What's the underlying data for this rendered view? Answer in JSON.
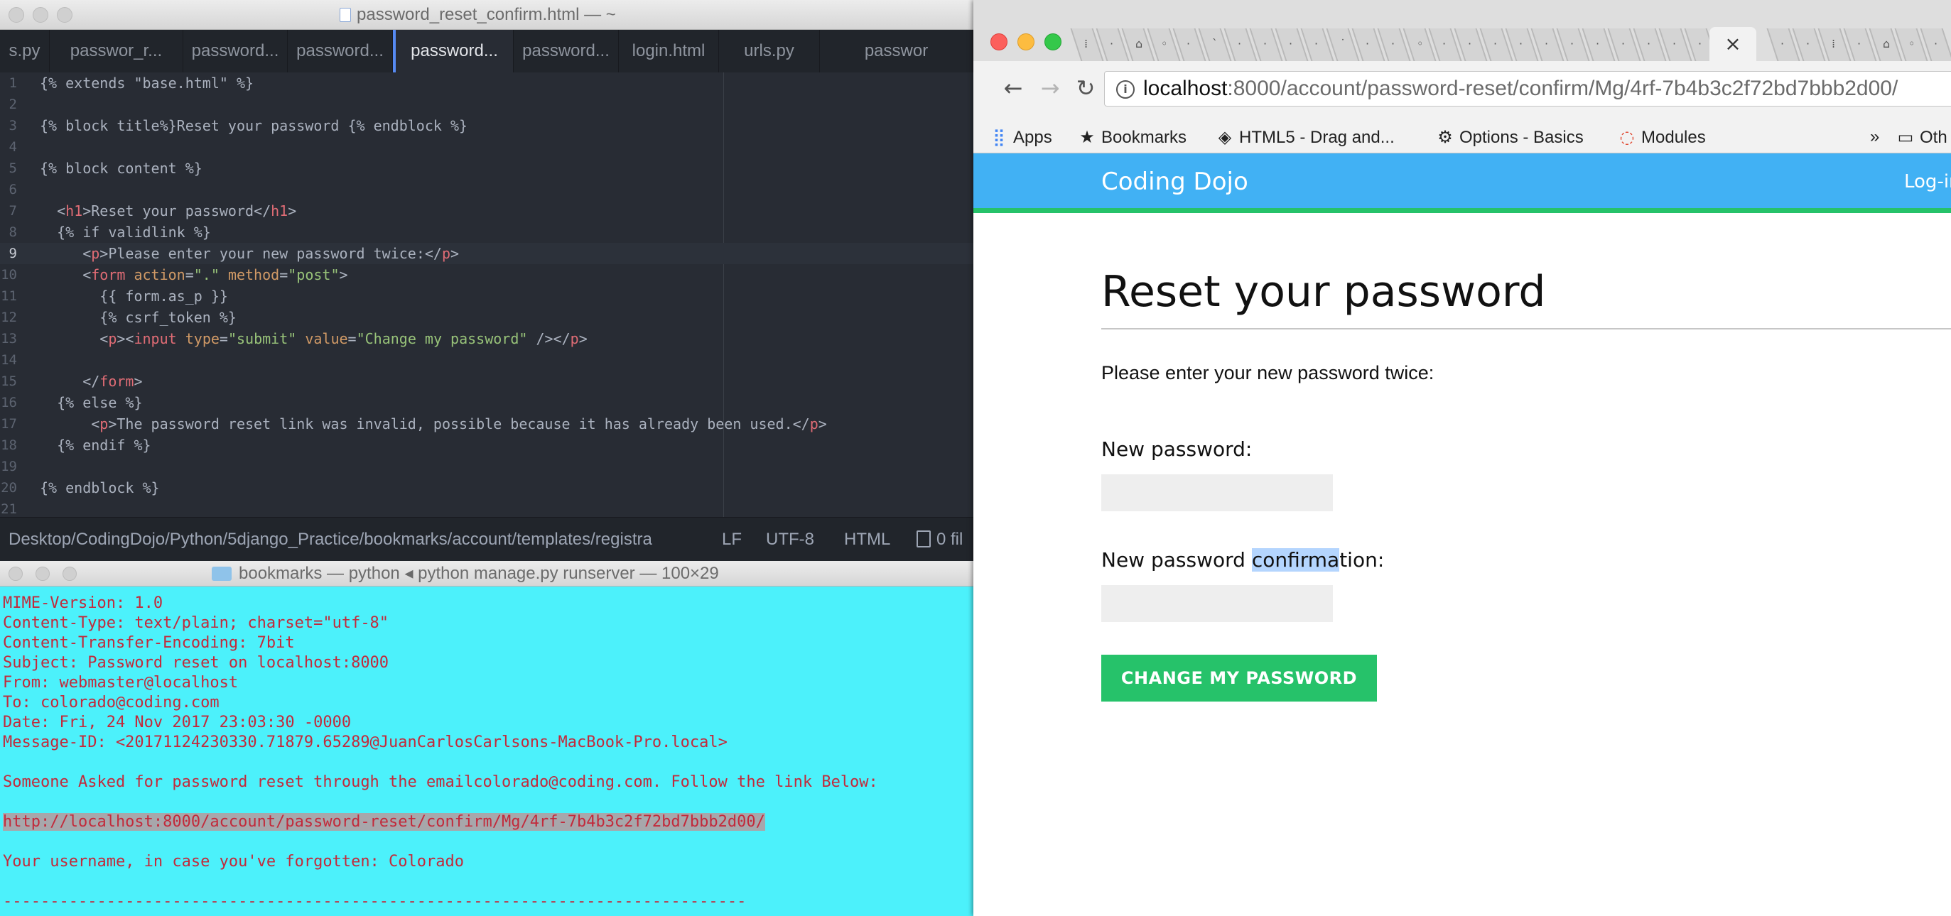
{
  "editor": {
    "window_title": "password_reset_confirm.html — ~",
    "tabs": [
      "s.py",
      "passwor_r...",
      "password...",
      "password...",
      "password...",
      "password...",
      "login.html",
      "urls.py",
      "passwor"
    ],
    "active_tab_index": 4,
    "line_numbers": [
      "1",
      "2",
      "3",
      "4",
      "5",
      "6",
      "7",
      "8",
      "9",
      "10",
      "11",
      "12",
      "13",
      "14",
      "15",
      "16",
      "17",
      "18",
      "19",
      "20",
      "21"
    ],
    "current_line": 9,
    "status": {
      "path": "Desktop/CodingDojo/Python/5django_Practice/bookmarks/account/templates/registra",
      "line_ending": "LF",
      "encoding": "UTF-8",
      "grammar": "HTML",
      "files": "0 fil"
    }
  },
  "terminal": {
    "window_title": "bookmarks — python ◂ python manage.py runserver — 100×29",
    "lines": [
      "MIME-Version: 1.0",
      "Content-Type: text/plain; charset=\"utf-8\"",
      "Content-Transfer-Encoding: 7bit",
      "Subject: Password reset on localhost:8000",
      "From: webmaster@localhost",
      "To: colorado@coding.com",
      "Date: Fri, 24 Nov 2017 23:03:30 -0000",
      "Message-ID: <20171124230330.71879.65289@JuanCarlosCarlsons-MacBook-Pro.local>",
      "",
      "Someone Asked for password reset through the emailcolorado@coding.com. Follow the link Below:",
      "",
      "http://localhost:8000/account/password-reset/confirm/Mg/4rf-7b4b3c2f72bd7bbb2d00/",
      "",
      "Your username, in case you've forgotten: Colorado",
      "",
      "-------------------------------------------------------------------------------"
    ],
    "selected_line_index": 11
  },
  "browser": {
    "active_tab_close": "×",
    "url_host": "localhost",
    "url_rest": ":8000/account/password-reset/confirm/Mg/4rf-7b4b3c2f72bd7bbb2d00/",
    "bookmarks": {
      "apps": "Apps",
      "bookmarks": "Bookmarks",
      "html5": "HTML5 - Drag and...",
      "options": "Options - Basics",
      "modules": "Modules",
      "more": "»",
      "other": "Oth"
    },
    "site": {
      "brand": "Coding Dojo",
      "login": "Log-in"
    },
    "page": {
      "heading": "Reset your password",
      "intro": "Please enter your new password twice:",
      "label_new": "New password:",
      "label_confirm_pre": "New password ",
      "label_confirm_hl": "confirma",
      "label_confirm_post": "tion:",
      "submit": "CHANGE MY PASSWORD"
    }
  },
  "colors": {
    "editor_bg": "#282c34",
    "terminal_bg": "#4cf1fb",
    "terminal_text": "#c22a3b",
    "site_nav": "#41b1f4",
    "accent_green": "#26c26a"
  }
}
